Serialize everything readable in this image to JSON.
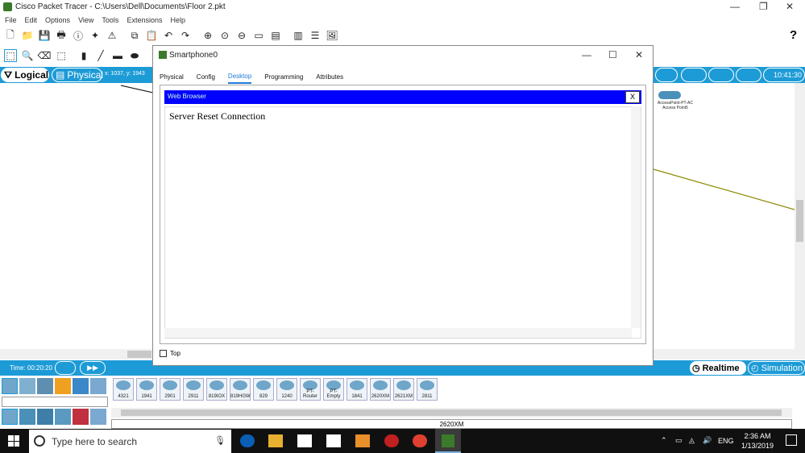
{
  "app": {
    "title": "Cisco Packet Tracer - C:\\Users\\Dell\\Documents\\Floor 2.pkt",
    "window_controls": [
      "—",
      "❐",
      "✕"
    ]
  },
  "menu": [
    "File",
    "Edit",
    "Options",
    "View",
    "Tools",
    "Extensions",
    "Help"
  ],
  "toolbar": {
    "help_label": "?"
  },
  "workspace": {
    "logical_label": "Logical",
    "physical_label": "Physical",
    "coords": "x: 1037, y: 1943",
    "clock": "10:41:30",
    "device_label_1": "AccessPoint-PT-AC",
    "device_label_2": "Access Point5"
  },
  "status": {
    "time": "Time: 00:20:20",
    "realtime_label": "Realtime",
    "simulation_label": "Simulation"
  },
  "devices": [
    "4321",
    "1941",
    "2901",
    "2911",
    "819IOX",
    "819HGW",
    "829",
    "1240",
    "PT-Router",
    "PT-Empty",
    "1841",
    "2620XM",
    "2621XM",
    "2811"
  ],
  "selected_device": "2620XM",
  "dialog": {
    "title": "Smartphone0",
    "tabs": [
      "Physical",
      "Config",
      "Desktop",
      "Programming",
      "Attributes"
    ],
    "active_tab": "Desktop",
    "browser_title": "Web Browser",
    "browser_close": "X",
    "message": "Server Reset Connection",
    "top_label": "Top"
  },
  "taskbar": {
    "search_placeholder": "Type here to search",
    "language": "ENG",
    "time": "2:36 AM",
    "date": "1/13/2019"
  }
}
